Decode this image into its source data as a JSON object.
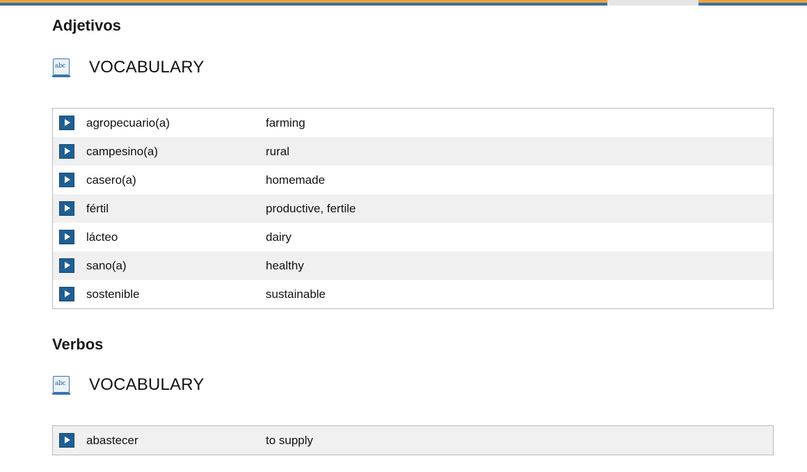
{
  "sections": [
    {
      "heading": "Adjetivos",
      "vocab_label": "VOCABULARY",
      "icon": "abc-book-icon",
      "icon_text": "abc",
      "rows": [
        {
          "term": "agropecuario(a)",
          "definition": "farming"
        },
        {
          "term": "campesino(a)",
          "definition": "rural"
        },
        {
          "term": "casero(a)",
          "definition": "homemade"
        },
        {
          "term": "fértil",
          "definition": "productive, fertile"
        },
        {
          "term": "lácteo",
          "definition": "dairy"
        },
        {
          "term": "sano(a)",
          "definition": "healthy"
        },
        {
          "term": "sostenible",
          "definition": "sustainable"
        }
      ]
    },
    {
      "heading": "Verbos",
      "vocab_label": "VOCABULARY",
      "icon": "abc-book-icon",
      "icon_text": "abc",
      "rows": [
        {
          "term": "abastecer",
          "definition": "to supply"
        }
      ]
    }
  ],
  "colors": {
    "top_bar_orange": "#e9a33d",
    "top_bar_blue": "#3e6fa3",
    "play_button": "#1f5f93",
    "row_shade": "#f0f0f0",
    "table_border": "#b9b9b9"
  },
  "play_icon": "play-icon"
}
